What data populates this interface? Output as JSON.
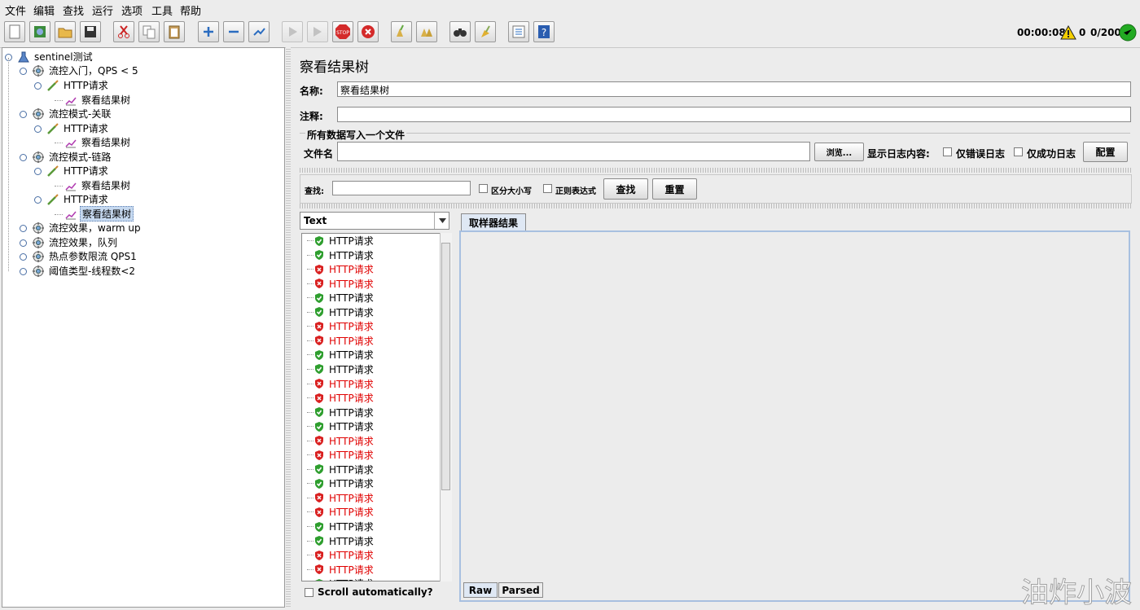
{
  "menu": [
    "文件",
    "编辑",
    "查找",
    "运行",
    "选项",
    "工具",
    "帮助"
  ],
  "status": {
    "elapsed": "00:00:08",
    "warnings": "0",
    "threads": "0/200"
  },
  "tree": [
    {
      "label": "sentinel测试",
      "icon": "test-plan-icon"
    },
    {
      "label": "流控入门，QPS < 5",
      "icon": "thread-group-icon"
    },
    {
      "label": "HTTP请求",
      "icon": "sampler-icon"
    },
    {
      "label": "察看结果树",
      "icon": "listener-icon"
    },
    {
      "label": "流控模式-关联",
      "icon": "thread-group-icon"
    },
    {
      "label": "HTTP请求",
      "icon": "sampler-icon"
    },
    {
      "label": "察看结果树",
      "icon": "listener-icon"
    },
    {
      "label": "流控模式-链路",
      "icon": "thread-group-icon"
    },
    {
      "label": "HTTP请求",
      "icon": "sampler-icon"
    },
    {
      "label": "察看结果树",
      "icon": "listener-icon"
    },
    {
      "label": "HTTP请求",
      "icon": "sampler-icon"
    },
    {
      "label": "察看结果树",
      "icon": "listener-icon"
    },
    {
      "label": "流控效果，warm up",
      "icon": "thread-group-icon"
    },
    {
      "label": "流控效果，队列",
      "icon": "thread-group-icon"
    },
    {
      "label": "热点参数限流 QPS1",
      "icon": "thread-group-icon"
    },
    {
      "label": "阈值类型-线程数<2",
      "icon": "thread-group-icon"
    }
  ],
  "panel": {
    "title": "察看结果树",
    "name_label": "名称:",
    "name_value": "察看结果树",
    "comment_label": "注释:",
    "comment_value": "",
    "file_group_title": "所有数据写入一个文件",
    "file_label": "文件名",
    "file_value": "",
    "browse_label": "浏览...",
    "log_content_label": "显示日志内容:",
    "errors_only_label": "仅错误日志",
    "success_only_label": "仅成功日志",
    "configure_label": "配置"
  },
  "search": {
    "label": "查找:",
    "value": "",
    "case_label": "区分大小写",
    "regex_label": "正则表达式",
    "find_label": "查找",
    "reset_label": "重置"
  },
  "results": {
    "renderer": "Text",
    "scroll_auto_label": "Scroll automatically?",
    "items": [
      {
        "label": "HTTP请求",
        "status": "ok"
      },
      {
        "label": "HTTP请求",
        "status": "ok"
      },
      {
        "label": "HTTP请求",
        "status": "error"
      },
      {
        "label": "HTTP请求",
        "status": "error"
      },
      {
        "label": "HTTP请求",
        "status": "ok"
      },
      {
        "label": "HTTP请求",
        "status": "ok"
      },
      {
        "label": "HTTP请求",
        "status": "error"
      },
      {
        "label": "HTTP请求",
        "status": "error"
      },
      {
        "label": "HTTP请求",
        "status": "ok"
      },
      {
        "label": "HTTP请求",
        "status": "ok"
      },
      {
        "label": "HTTP请求",
        "status": "error"
      },
      {
        "label": "HTTP请求",
        "status": "error"
      },
      {
        "label": "HTTP请求",
        "status": "ok"
      },
      {
        "label": "HTTP请求",
        "status": "ok"
      },
      {
        "label": "HTTP请求",
        "status": "error"
      },
      {
        "label": "HTTP请求",
        "status": "error"
      },
      {
        "label": "HTTP请求",
        "status": "ok"
      },
      {
        "label": "HTTP请求",
        "status": "ok"
      },
      {
        "label": "HTTP请求",
        "status": "error"
      },
      {
        "label": "HTTP请求",
        "status": "error"
      },
      {
        "label": "HTTP请求",
        "status": "ok"
      },
      {
        "label": "HTTP请求",
        "status": "ok"
      },
      {
        "label": "HTTP请求",
        "status": "error"
      },
      {
        "label": "HTTP请求",
        "status": "error"
      },
      {
        "label": "HTTP请求",
        "status": "ok"
      }
    ]
  },
  "tabs": {
    "sampler_result": "取样器结果",
    "raw": "Raw",
    "parsed": "Parsed"
  },
  "watermark": "油炸小波",
  "colors": {
    "ok": "#2e9e2e",
    "error": "#d92020",
    "selected": "#c6d9f0",
    "status_green": "#22aa22"
  }
}
